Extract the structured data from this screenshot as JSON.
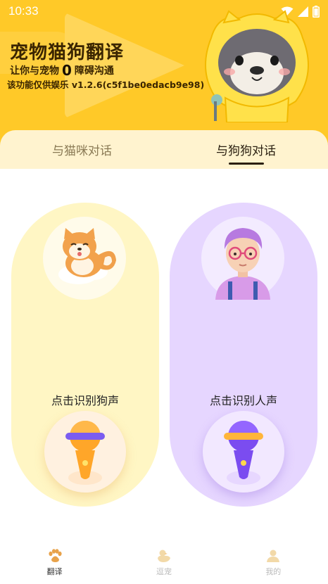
{
  "status_bar": {
    "time": "10:33",
    "icons": [
      "wifi-icon",
      "signal-icon",
      "battery-icon"
    ]
  },
  "header": {
    "title": "宠物猫狗翻译",
    "tagline_prefix": "让你与宠物",
    "tagline_number": "0",
    "tagline_suffix": "障碍沟通",
    "disclaimer": "该功能仅供娱乐 v1.2.6(c5f1be0edacb9e98)"
  },
  "tabs": [
    {
      "label": "与猫咪对话",
      "active": false
    },
    {
      "label": "与狗狗对话",
      "active": true
    }
  ],
  "cards": {
    "dog": {
      "label": "点击识别狗声",
      "avatar": "shiba-dog-avatar",
      "mic": "microphone-icon"
    },
    "human": {
      "label": "点击识别人声",
      "avatar": "person-avatar",
      "mic": "microphone-icon"
    }
  },
  "bottom_nav": [
    {
      "label": "翻译",
      "icon": "paw-icon",
      "active": true
    },
    {
      "label": "逗宠",
      "icon": "duck-icon",
      "active": false
    },
    {
      "label": "我的",
      "icon": "user-icon",
      "active": false
    }
  ],
  "colors": {
    "header_bg": "#FFC928",
    "dog_card": "#FFF6C4",
    "human_card": "#E6D6FF",
    "tab_bar": "#FFF3CF"
  }
}
